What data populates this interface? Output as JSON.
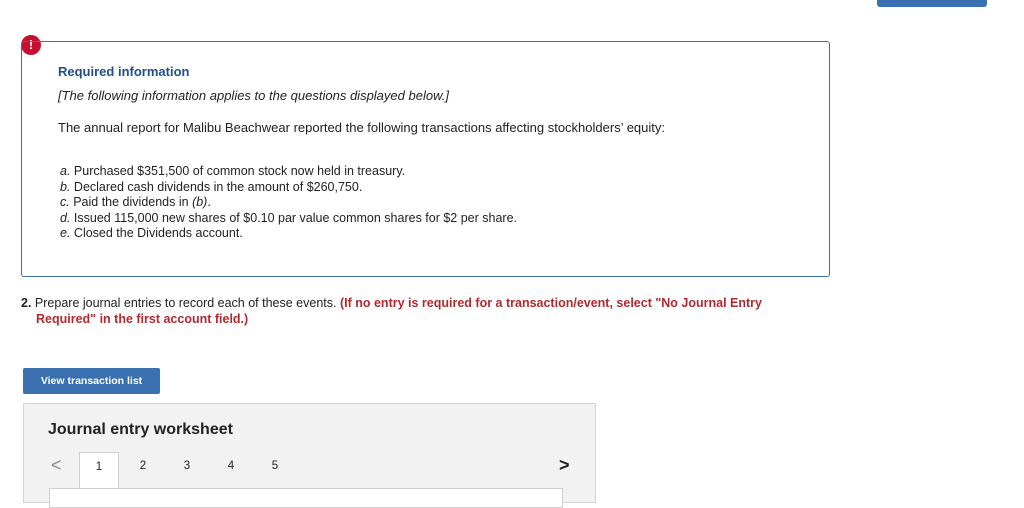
{
  "alert": {
    "icon": "exclamation-icon",
    "glyph": "!"
  },
  "info": {
    "title": "Required information",
    "note": "[The following information applies to the questions displayed below.]",
    "text": "The annual report for Malibu Beachwear reported the following transactions affecting stockholders’ equity:",
    "transactions": [
      {
        "letter": "a.",
        "text": "Purchased $351,500 of common stock now held in treasury."
      },
      {
        "letter": "b.",
        "text": "Declared cash dividends in the amount of $260,750."
      },
      {
        "letter": "c.",
        "text": "Paid the dividends in ",
        "ref": "(b)",
        "tail": "."
      },
      {
        "letter": "d.",
        "text": "Issued 115,000 new shares of $0.10 par value common shares for $2 per share."
      },
      {
        "letter": "e.",
        "text": "Closed the Dividends account."
      }
    ]
  },
  "question": {
    "number": "2.",
    "text": "Prepare journal entries to record each of these events.",
    "hint_line1": "(If no entry is required for a transaction/event, select \"No Journal Entry",
    "hint_line2": "Required\" in the first account field.)"
  },
  "view_button": {
    "label": "View transaction list"
  },
  "worksheet": {
    "title": "Journal entry worksheet",
    "prev_glyph": "<",
    "next_glyph": ">",
    "tabs": [
      "1",
      "2",
      "3",
      "4",
      "5"
    ],
    "active_tab": "1"
  },
  "colors": {
    "accent": "#3a6fb0",
    "alert": "#c8102e",
    "hint": "#b2292e"
  }
}
